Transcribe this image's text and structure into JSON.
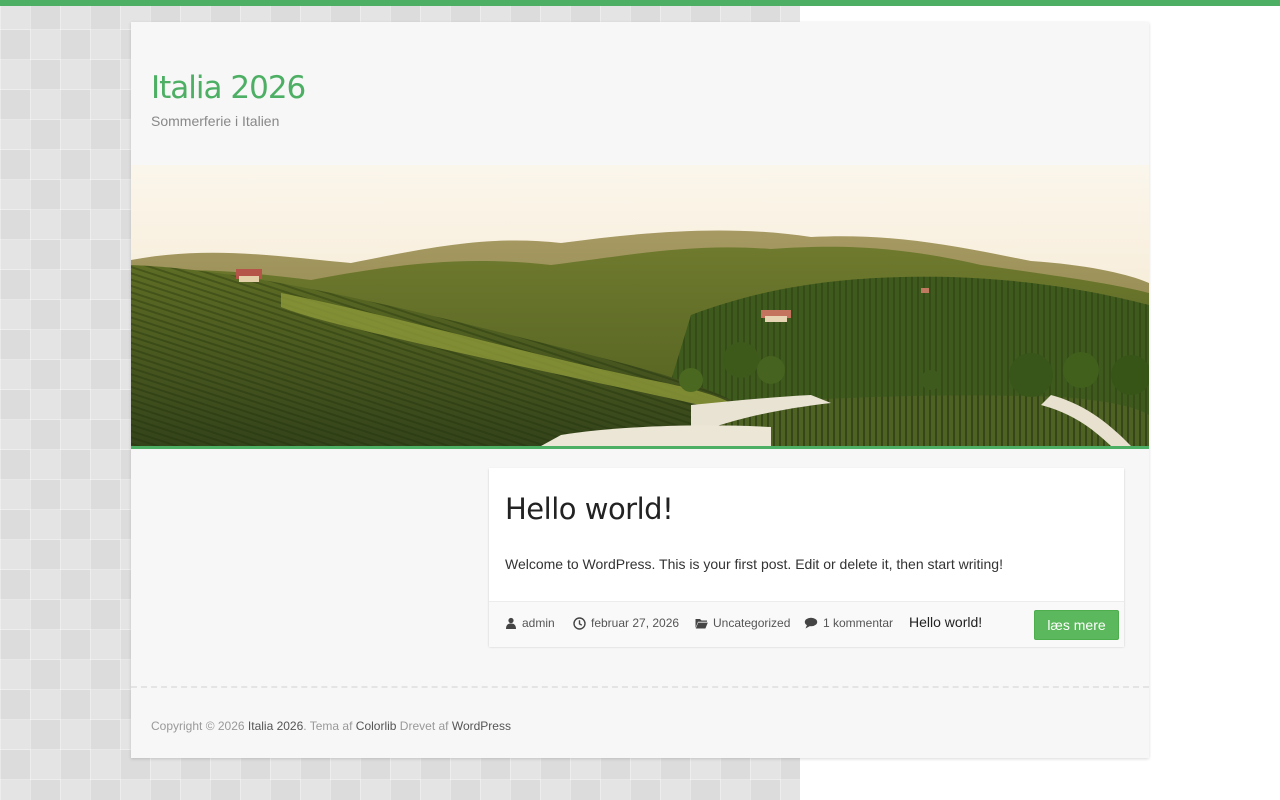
{
  "header": {
    "site_title": "Italia 2026",
    "tagline": "Sommerferie i Italien"
  },
  "hero": {
    "image": "vineyard-hills-landscape"
  },
  "post": {
    "title": "Hello world!",
    "excerpt": "Welcome to WordPress. This is your first post. Edit or delete it, then start writing!",
    "meta": {
      "author": "admin",
      "date": "februar 27, 2026",
      "category": "Uncategorized",
      "comments": "1 kommentar",
      "post_link": "Hello world!"
    },
    "read_more_label": "læs mere"
  },
  "footer": {
    "copyright_prefix": "Copyright © 2026 ",
    "site_link": "Italia 2026",
    "theme_text": ". Tema af ",
    "theme_link": "Colorlib",
    "powered_text": " Drevet af ",
    "powered_link": "WordPress"
  },
  "colors": {
    "accent": "#4caf63",
    "button": "#5cb85c",
    "title_text": "#222222"
  },
  "icons": [
    "user-icon",
    "clock-icon",
    "folder-icon",
    "comment-icon"
  ]
}
